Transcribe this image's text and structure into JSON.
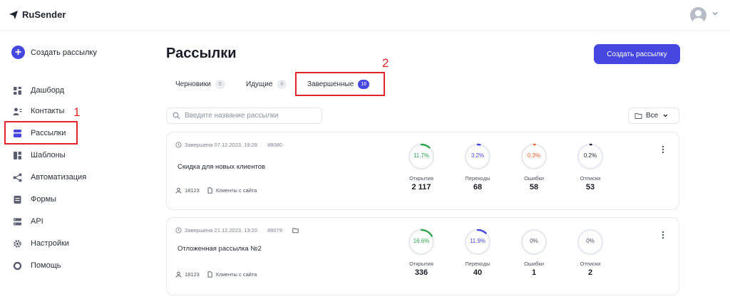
{
  "app": {
    "name": "RuSender"
  },
  "sidebar": {
    "create_label": "Создать рассылку",
    "items": [
      {
        "label": "Дашборд"
      },
      {
        "label": "Контакты"
      },
      {
        "label": "Рассылки"
      },
      {
        "label": "Шаблоны"
      },
      {
        "label": "Автоматизация"
      },
      {
        "label": "Формы"
      },
      {
        "label": "API"
      },
      {
        "label": "Настройки"
      },
      {
        "label": "Помощь"
      }
    ]
  },
  "annotations": {
    "marker_1": "1",
    "marker_2": "2",
    "color": "#e0262b"
  },
  "main": {
    "title": "Рассылки",
    "create_button": "Создать рассылку",
    "tabs": [
      {
        "label": "Черновики",
        "count": "0"
      },
      {
        "label": "Идущие",
        "count": "0"
      },
      {
        "label": "Завершенные",
        "count": "16",
        "active": true
      }
    ],
    "search_placeholder": "Введите название рассылки",
    "filter_label": "Все",
    "campaigns": [
      {
        "status": "Завершена 07.12.2023, 19:28",
        "id": "#8080",
        "name": "Скидка для новых клиентов",
        "recipients": "18123",
        "list": "Клиенты с сайта",
        "metrics": [
          {
            "label": "Открытия",
            "percent": "11.7%",
            "fraction": 0.117,
            "value": "2 117",
            "color": "#2ea44f"
          },
          {
            "label": "Переходы",
            "percent": "3.2%",
            "fraction": 0.032,
            "value": "68",
            "color": "#4547e0"
          },
          {
            "label": "Ошибки",
            "percent": "0.3%",
            "fraction": 0.003,
            "value": "58",
            "color": "#f0602b"
          },
          {
            "label": "Отписки",
            "percent": "0.2%",
            "fraction": 0.002,
            "value": "53",
            "color": "#1f2430"
          }
        ]
      },
      {
        "status": "Завершена 21.12.2023, 13:20",
        "id": "#8079",
        "name": "Отложенная рассылка №2",
        "recipients": "18123",
        "list": "Клиенты с сайта",
        "metrics": [
          {
            "label": "Открытия",
            "percent": "16.6%",
            "fraction": 0.166,
            "value": "336",
            "color": "#2ea44f"
          },
          {
            "label": "Переходы",
            "percent": "11.9%",
            "fraction": 0.119,
            "value": "40",
            "color": "#4547e0"
          },
          {
            "label": "Ошибки",
            "percent": "0%",
            "fraction": 0,
            "value": "1",
            "color": "#f0602b"
          },
          {
            "label": "Отписки",
            "percent": "0%",
            "fraction": 0,
            "value": "2",
            "color": "#1f2430"
          }
        ]
      }
    ]
  },
  "colors": {
    "accent": "#4547e0",
    "ring_track": "#e8eaef"
  }
}
